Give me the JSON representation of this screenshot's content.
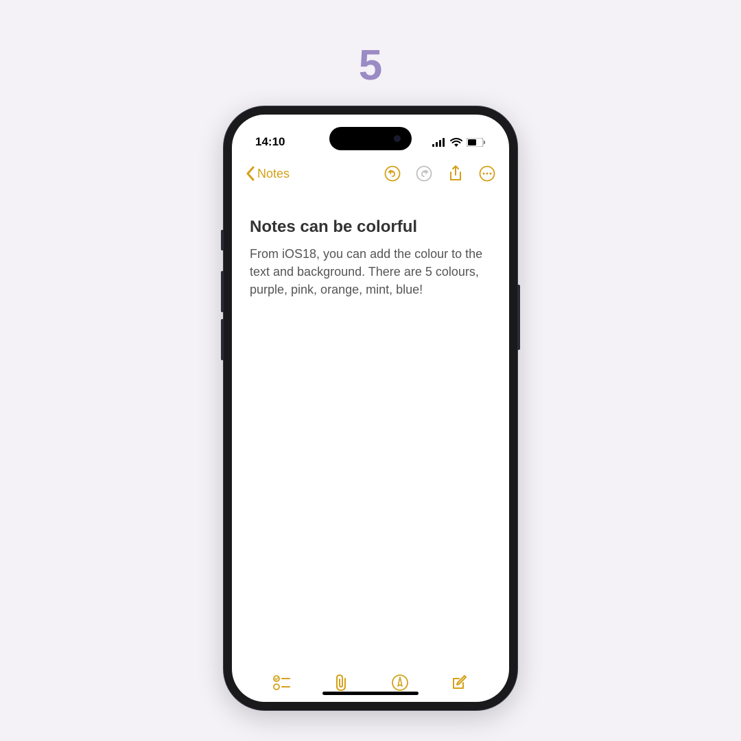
{
  "page": {
    "number": "5"
  },
  "statusBar": {
    "time": "14:10"
  },
  "nav": {
    "backLabel": "Notes"
  },
  "note": {
    "title": "Notes can be colorful",
    "body": "From iOS18, you can add the colour to the text and background. There are 5 colours, purple, pink, orange, mint, blue!"
  },
  "colors": {
    "accent": "#d4a017",
    "disabled": "#c0c0c0"
  }
}
